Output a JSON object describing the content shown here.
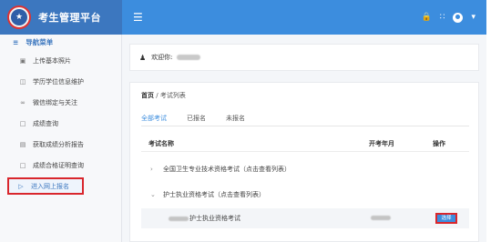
{
  "header": {
    "app_title": "考生管理平台",
    "menu_icon": "hamburger-icon",
    "right_icons": [
      "lock-icon",
      "grid-icon",
      "user-icon",
      "chevron-down-icon"
    ]
  },
  "sidebar": {
    "heading": "导航菜单",
    "items": [
      {
        "label": "上传基本照片",
        "icon": "image-icon"
      },
      {
        "label": "学历学位信息维护",
        "icon": "document-icon"
      },
      {
        "label": "微信绑定与关注",
        "icon": "link-icon"
      },
      {
        "label": "成绩查询",
        "icon": "file-icon"
      },
      {
        "label": "获取成绩分析报告",
        "icon": "report-icon"
      },
      {
        "label": "成绩合格证明查询",
        "icon": "certificate-icon"
      },
      {
        "label": "进入网上报名",
        "icon": "enter-icon"
      }
    ]
  },
  "welcome": {
    "label": "欢迎你:"
  },
  "breadcrumb": {
    "home": "首页",
    "current": "考试列表"
  },
  "tabs": [
    "全部考试",
    "已报名",
    "未报名"
  ],
  "table": {
    "headers": [
      "考试名称",
      "开考年月",
      "操作"
    ],
    "groups": [
      {
        "title": "全国卫生专业技术资格考试（点击查看列表）",
        "expanded": false
      },
      {
        "title": "护士执业资格考试（点击查看列表）",
        "expanded": true
      }
    ],
    "row": {
      "name_suffix": "护士执业资格考试",
      "action": "选择"
    }
  },
  "colors": {
    "brand": "#3c77bf",
    "topbar": "#3c8dde",
    "highlight": "#d9262c"
  }
}
